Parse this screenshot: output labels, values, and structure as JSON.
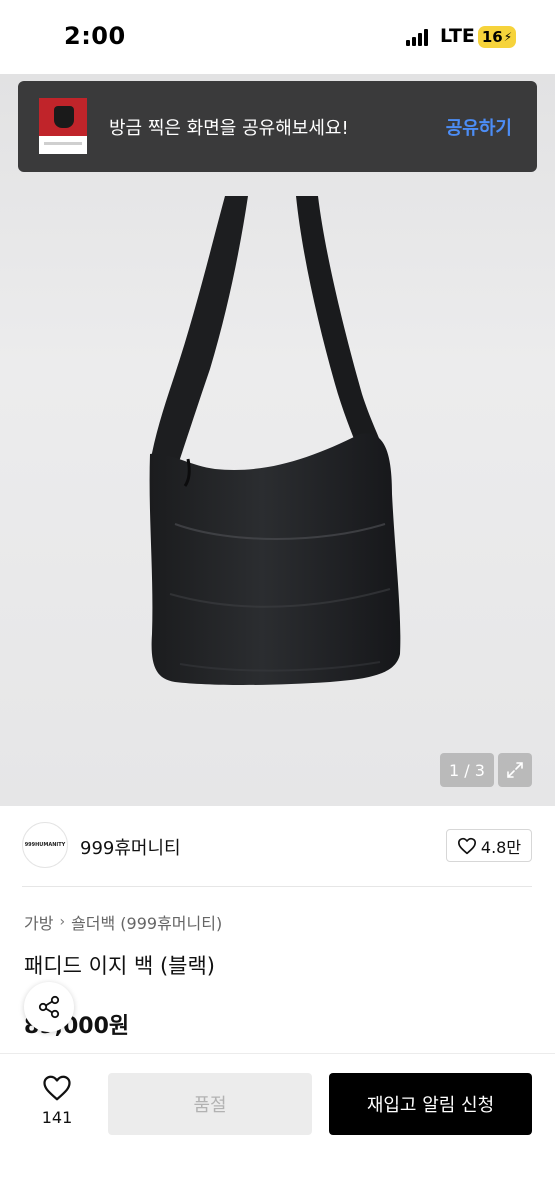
{
  "status_bar": {
    "time": "2:00",
    "network": "LTE",
    "battery": "16"
  },
  "toast": {
    "message": "방금 찍은 화면을 공유해보세요!",
    "action_label": "공유하기"
  },
  "gallery": {
    "pager": "1 / 3"
  },
  "brand": {
    "logo_text": "999HUMANITY",
    "name": "999휴머니티",
    "likes": "4.8만"
  },
  "breadcrumb": {
    "category": "가방",
    "subcategory": "숄더백 (999휴머니티)"
  },
  "product": {
    "title": "패디드 이지 백 (블랙)",
    "price": "89,000원"
  },
  "bottom_bar": {
    "wish_count": "141",
    "soldout_label": "품절",
    "restock_label": "재입고 알림 신청"
  },
  "colors": {
    "toast_bg": "#3a3a3b",
    "toast_action": "#4c8df6",
    "primary_button": "#000000",
    "disabled_button": "#ececec"
  },
  "icons": [
    "signal-icon",
    "battery-icon",
    "expand-icon",
    "heart-icon",
    "share-icon",
    "chevron-right-icon"
  ]
}
